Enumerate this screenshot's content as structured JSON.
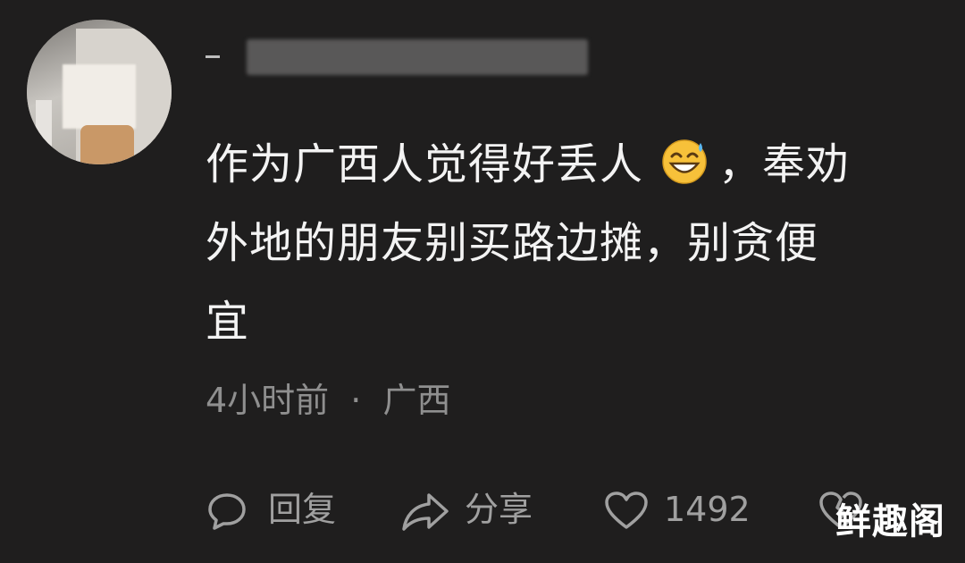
{
  "comment": {
    "text_line1_part1": "作为广西人觉得好丢人",
    "emoji_name": "grinning-face-with-sweat-icon",
    "text_line1_part2": "，奉劝",
    "text_line2": "外地的朋友别买路边摊，别贪便",
    "text_line3": "宜"
  },
  "meta": {
    "time": "4小时前",
    "separator": "·",
    "location": "广西"
  },
  "actions": {
    "reply_label": "回复",
    "share_label": "分享",
    "like_count": "1492"
  },
  "watermark": {
    "text": "鲜趣阁"
  },
  "colors": {
    "background": "#1f1e1e",
    "text": "#f3f3f3",
    "muted": "#8f8f8f",
    "icon": "#a0a0a0"
  }
}
